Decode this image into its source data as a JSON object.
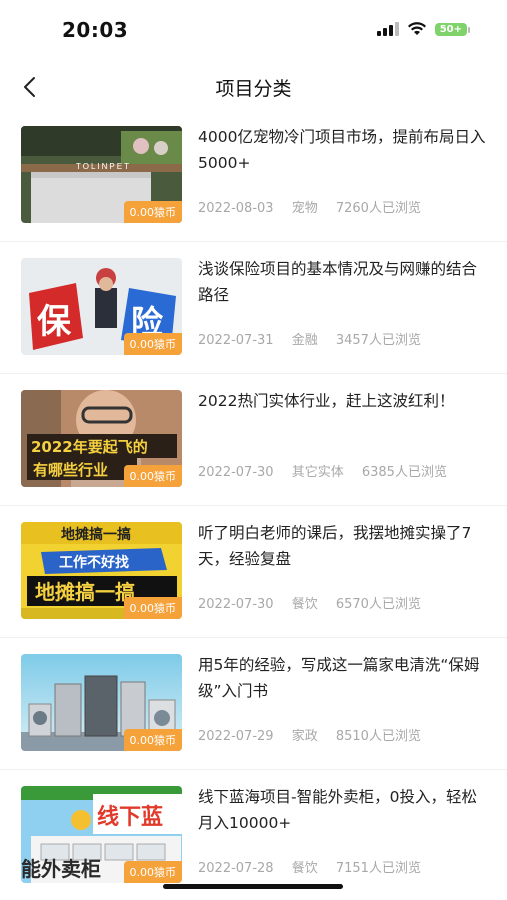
{
  "status_bar": {
    "time": "20:03",
    "battery": "50+"
  },
  "header": {
    "title": "项目分类"
  },
  "items": [
    {
      "title": "4000亿宠物冷门项目市场，提前布局日入5000+",
      "price": "0.00猿币",
      "date": "2022-08-03",
      "category": "宠物",
      "views": "7260人已浏览"
    },
    {
      "title": "浅谈保险项目的基本情况及与网赚的结合路径",
      "price": "0.00猿币",
      "date": "2022-07-31",
      "category": "金融",
      "views": "3457人已浏览",
      "thumb_text": [
        "保",
        "险"
      ]
    },
    {
      "title": "2022热门实体行业，赶上这波红利！",
      "price": "0.00猿币",
      "date": "2022-07-30",
      "category": "其它实体",
      "views": "6385人已浏览",
      "thumb_text": [
        "2022年要起飞的",
        "有哪些行业"
      ]
    },
    {
      "title": "听了明白老师的课后，我摆地摊实操了7天，经验复盘",
      "price": "0.00猿币",
      "date": "2022-07-30",
      "category": "餐饮",
      "views": "6570人已浏览",
      "thumb_text": [
        "地摊搞一搞",
        "工作不好找",
        "地摊搞一搞"
      ]
    },
    {
      "title": "用5年的经验，写成这一篇家电清洗“保姆级”入门书",
      "price": "0.00猿币",
      "date": "2022-07-29",
      "category": "家政",
      "views": "8510人已浏览"
    },
    {
      "title": "线下蓝海项目-智能外卖柜，0投入，轻松月入10000+",
      "price": "0.00猿币",
      "date": "2022-07-28",
      "category": "餐饮",
      "views": "7151人已浏览",
      "thumb_text": [
        "线下蓝",
        "能外卖柜"
      ]
    }
  ],
  "colors": {
    "badge": "#f6a23a",
    "meta": "#a8a8a8",
    "battery": "#7fd36a"
  }
}
